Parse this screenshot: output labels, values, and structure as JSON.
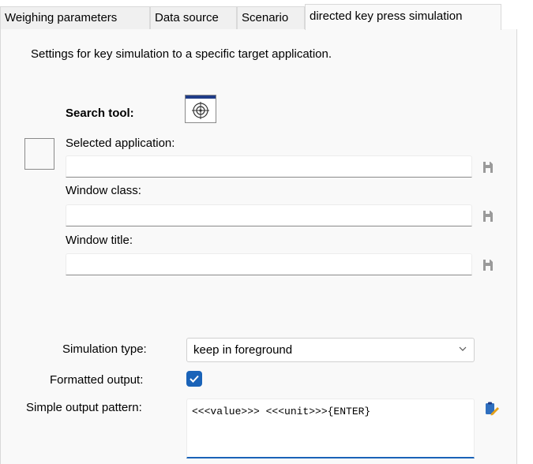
{
  "tabs": [
    {
      "label": "Weighing parameters"
    },
    {
      "label": "Data source"
    },
    {
      "label": "Scenario"
    },
    {
      "label": "directed key press simulation",
      "active": true
    }
  ],
  "description": "Settings for key simulation to a specific target application.",
  "search_tool": {
    "label": "Search tool:",
    "icon": "crosshair-target-icon"
  },
  "fields": {
    "selected_application": {
      "label": "Selected application:",
      "value": "",
      "save_icon": "floppy-disk-icon"
    },
    "window_class": {
      "label": "Window class:",
      "value": "",
      "save_icon": "floppy-disk-icon"
    },
    "window_title": {
      "label": "Window title:",
      "value": "",
      "save_icon": "floppy-disk-icon"
    }
  },
  "simulation_type": {
    "label": "Simulation type:",
    "value": "keep in foreground"
  },
  "formatted_output": {
    "label": "Formatted output:",
    "checked": true
  },
  "output_pattern": {
    "label": "Simple output pattern:",
    "value": "<<<value>>> <<<unit>>>{ENTER}",
    "edit_icon": "clipboard-edit-icon"
  },
  "colors": {
    "accent": "#1a63b8",
    "panel": "#f9f9f9",
    "tab_inactive": "#f0f0f0"
  }
}
